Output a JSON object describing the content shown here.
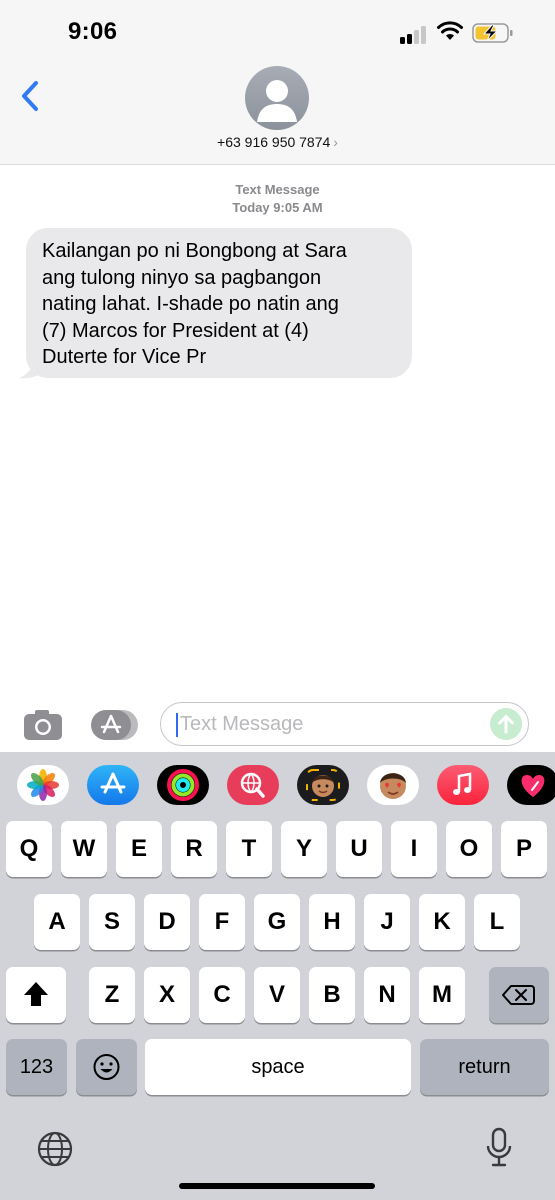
{
  "status": {
    "time": "9:06"
  },
  "header": {
    "contact": "+63 916 950 7874"
  },
  "thread": {
    "label": "Text Message",
    "timestamp": "Today 9:05 AM",
    "messages": [
      {
        "text": "Kailangan po ni Bongbong at Sara\nang tulong ninyo sa pagbangon\nnating lahat.  I-shade po natin ang\n(7) Marcos for President at (4)\nDuterte for Vice Pr"
      }
    ]
  },
  "composer": {
    "placeholder": "Text Message"
  },
  "app_strip": [
    "photos-icon",
    "app-store-icon",
    "fitness-icon",
    "web-images-icon",
    "memoji-icon",
    "animoji-icon",
    "music-icon",
    "digital-touch-icon"
  ],
  "keyboard": {
    "row1": [
      "Q",
      "W",
      "E",
      "R",
      "T",
      "Y",
      "U",
      "I",
      "O",
      "P"
    ],
    "row2": [
      "A",
      "S",
      "D",
      "F",
      "G",
      "H",
      "J",
      "K",
      "L"
    ],
    "row3": [
      "Z",
      "X",
      "C",
      "V",
      "B",
      "N",
      "M"
    ],
    "numbers": "123",
    "space": "space",
    "return": "return"
  }
}
